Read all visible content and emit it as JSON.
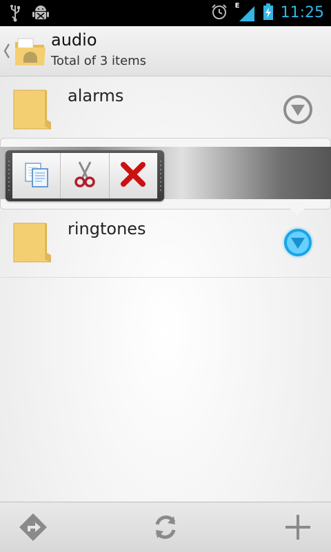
{
  "statusbar": {
    "time": "11:25",
    "network_type": "E",
    "icons": [
      "usb-icon",
      "android-debug-icon",
      "alarm-clock-icon",
      "signal-icon",
      "battery-charging-icon"
    ]
  },
  "actionbar": {
    "title": "audio",
    "subtitle": "Total of 3 items",
    "icons": [
      "up-caret-icon",
      "folder-logo-icon"
    ]
  },
  "folders": [
    {
      "name": "alarms"
    },
    {
      "name": "ringtones"
    }
  ],
  "quick_actions": [
    {
      "icon": "copy-icon"
    },
    {
      "icon": "cut-icon"
    },
    {
      "icon": "delete-icon"
    }
  ],
  "bottombar": {
    "icons": [
      "go-to-icon",
      "refresh-icon",
      "add-icon"
    ]
  },
  "colors": {
    "accent": "#33b5e5",
    "folder": "#f4cf72",
    "delete": "#cc1111"
  }
}
